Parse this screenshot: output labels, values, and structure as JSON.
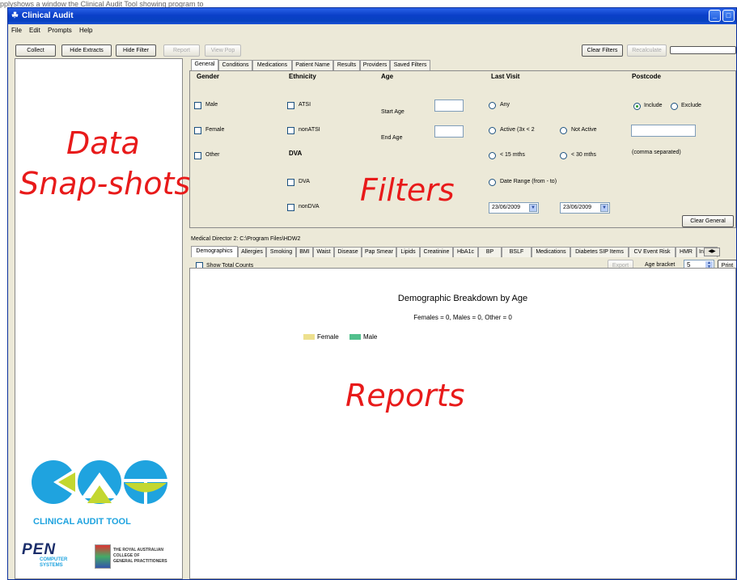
{
  "window": {
    "title": "Clinical Audit",
    "caption": "pplyshows a window  the Clinical Audit Tool showing  program  to"
  },
  "menu": [
    "File",
    "Edit",
    "Prompts",
    "Help"
  ],
  "toolbar": {
    "collect": "Collect",
    "hide_extracts": "Hide Extracts",
    "hide_filter": "Hide Filter",
    "report": "Report",
    "view_pop": "View Pop",
    "clear_filters": "Clear Filters",
    "recalculate": "Recalculate"
  },
  "overlays": {
    "data_line1": "Data",
    "data_line2": "Snap-shots",
    "filters": "Filters",
    "reports": "Reports"
  },
  "filter_tabs": [
    "General",
    "Conditions",
    "Medications",
    "Patient Name",
    "Results",
    "Providers",
    "Saved Filters"
  ],
  "general": {
    "gender": {
      "header": "Gender",
      "options": [
        "Male",
        "Female",
        "Other"
      ]
    },
    "ethnicity": {
      "header": "Ethnicity",
      "options": [
        "ATSI",
        "nonATSI"
      ]
    },
    "dva": {
      "header": "DVA",
      "options": [
        "DVA",
        "nonDVA"
      ]
    },
    "age": {
      "header": "Age",
      "start": "Start Age",
      "end": "End Age"
    },
    "last_visit": {
      "header": "Last Visit",
      "any": "Any",
      "active": "Active (3x < 2",
      "not_active": "Not Active",
      "lt15": "< 15 mths",
      "lt30": "< 30 mths",
      "date_range": "Date Range (from - to)",
      "from_date": "23/06/2009",
      "to_date": "23/06/2009"
    },
    "postcode": {
      "header": "Postcode",
      "include": "Include",
      "exclude": "Exclude",
      "note": "(comma separated)"
    },
    "clear_general": "Clear General"
  },
  "source_path": "Medical Director 2: C:\\Program Files\\HDW2",
  "report_tabs": [
    "Demographics",
    "Allergies",
    "Smoking",
    "BMI",
    "Waist",
    "Disease",
    "Pap Smear",
    "Lipids",
    "Creatinine",
    "HbA1c",
    "BP",
    "BSLF",
    "Medications",
    "Diabetes SIP Items",
    "CV Event Risk",
    "HMR",
    "In"
  ],
  "report": {
    "show_total_counts": "Show Total Counts",
    "export": "Export",
    "age_bracket_label": "Age bracket",
    "age_bracket_value": "5",
    "print": "Print",
    "chart_title": "Demographic Breakdown by Age",
    "chart_subtitle": "Females = 0, Males = 0, Other = 0"
  },
  "chart_data": {
    "type": "bar",
    "title": "Demographic Breakdown by Age",
    "subtitle": "Females = 0, Males = 0, Other = 0",
    "series": [
      {
        "name": "Female",
        "color": "#ede08e",
        "values": []
      },
      {
        "name": "Male",
        "color": "#52c08d",
        "values": []
      }
    ]
  },
  "branding": {
    "logo_text": "CLINICAL AUDIT TOOL",
    "pen_line1": "PEN",
    "pen_line2": "COMPUTER",
    "pen_line3": "SYSTEMS",
    "racgp_line1": "The Royal Australian",
    "racgp_line2": "College of",
    "racgp_line3": "General Practitioners"
  },
  "colors": {
    "overlay_red": "#e81a1a",
    "logo_blue": "#1fa3df",
    "logo_green": "#c3d730",
    "title_blue": "#0842c0"
  }
}
